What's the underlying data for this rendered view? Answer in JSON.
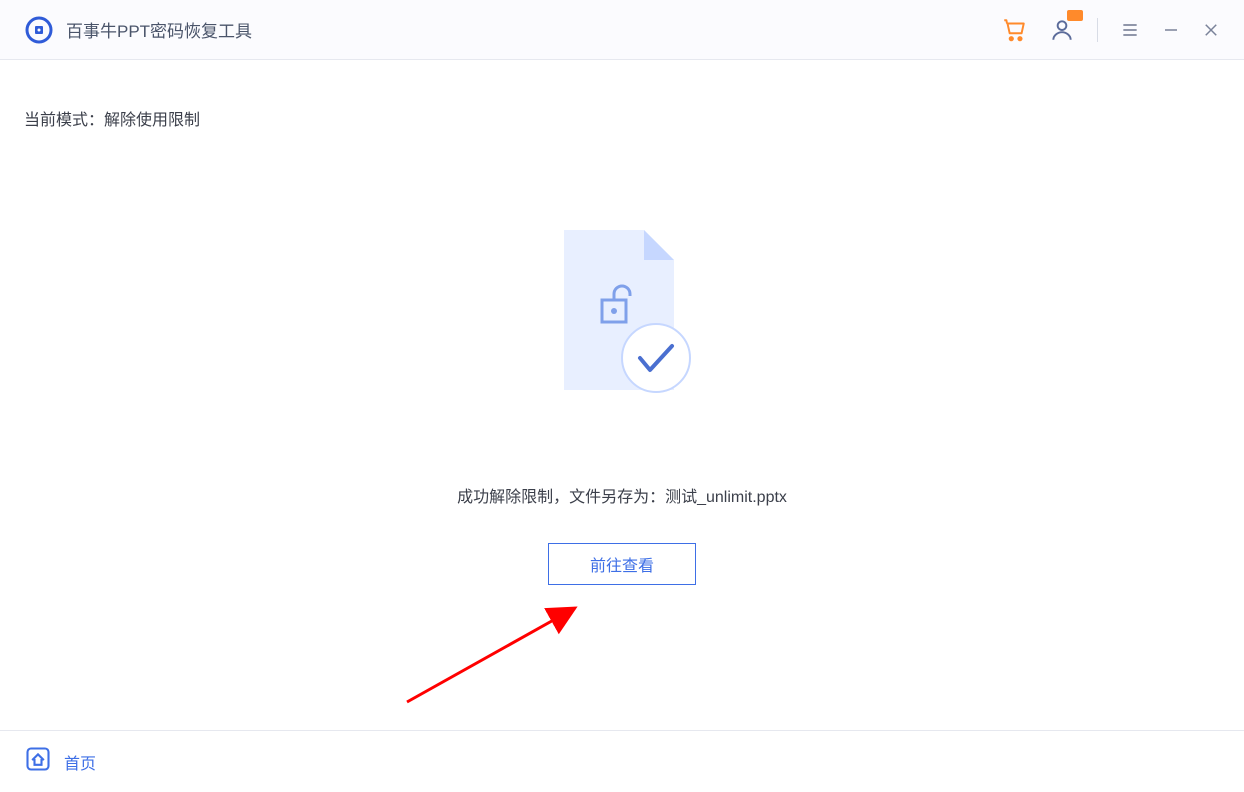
{
  "header": {
    "title": "百事牛PPT密码恢复工具"
  },
  "content": {
    "mode_label_prefix": "当前模式：",
    "mode_value": "解除使用限制",
    "success_prefix": "成功解除限制，文件另存为：",
    "saved_filename": "测试_unlimit.pptx",
    "view_button": "前往查看"
  },
  "footer": {
    "home": "首页"
  }
}
